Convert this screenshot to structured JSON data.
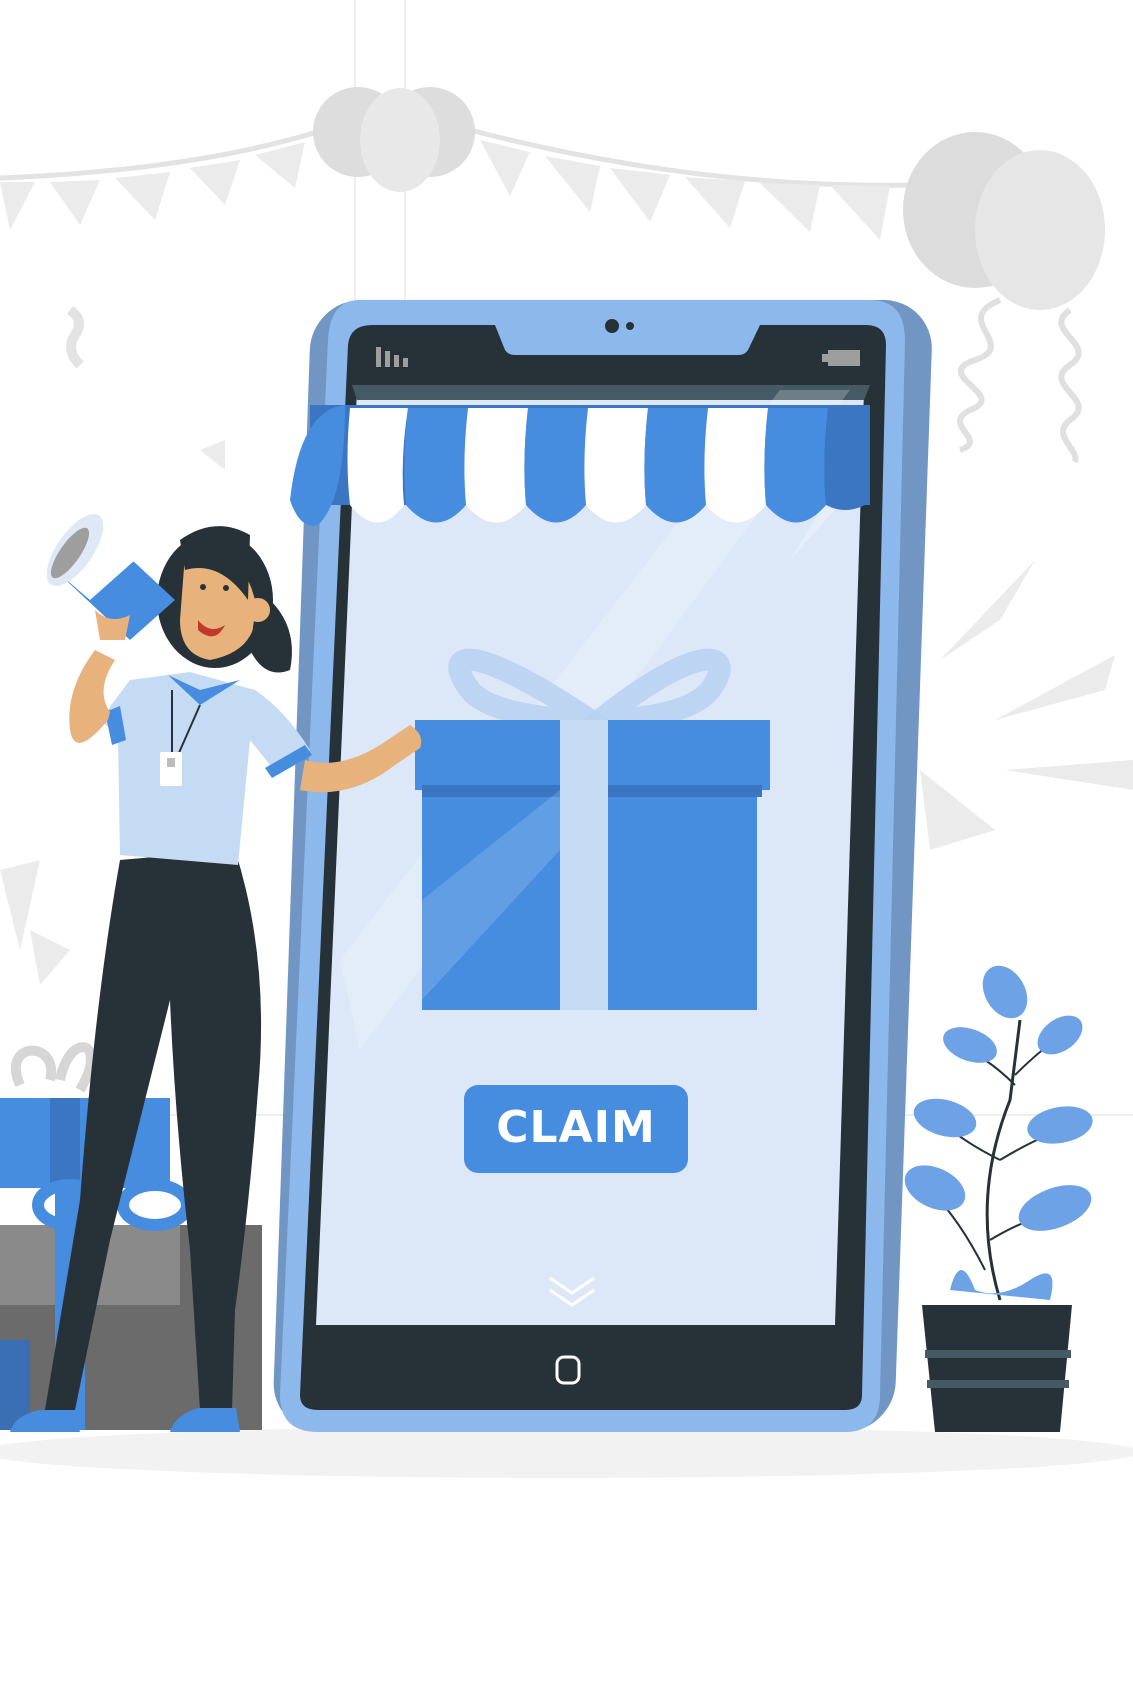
{
  "phone": {
    "claim_label": "CLAIM",
    "home_icon": "home-button-icon",
    "scroll_icon": "double-chevron-down-icon",
    "signal_icon": "signal-bars-icon",
    "battery_icon": "battery-icon"
  },
  "colors": {
    "brand_blue": "#468de0",
    "light_blue": "#8db8ec",
    "screen_bg": "#dce8f8",
    "dark": "#263238",
    "gray_decor": "#e0e0e0",
    "white": "#ffffff"
  }
}
